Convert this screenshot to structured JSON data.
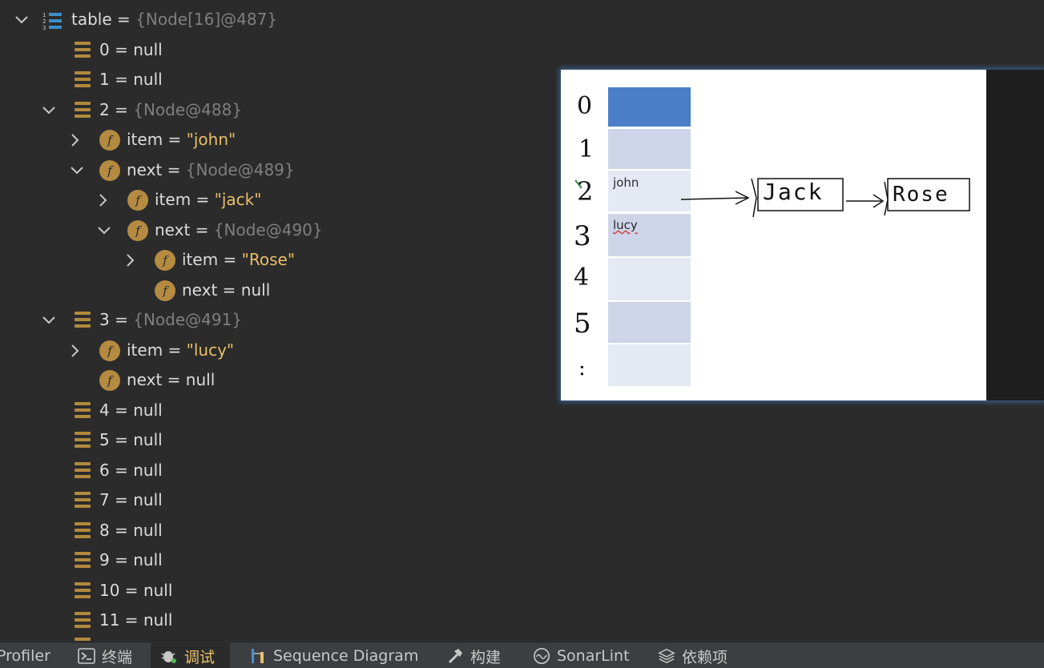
{
  "variables": {
    "rows": [
      {
        "name": "table",
        "eq": " = ",
        "value": "{Node[16]@487}",
        "kind": "ref",
        "icon": "list-icon",
        "chevron": "expanded"
      },
      {
        "name": "0",
        "eq": " = ",
        "value": "null",
        "kind": "plain",
        "icon": "array-element-icon",
        "chevron": "none"
      },
      {
        "name": "1",
        "eq": " = ",
        "value": "null",
        "kind": "plain",
        "icon": "array-element-icon",
        "chevron": "none"
      },
      {
        "name": "2",
        "eq": " = ",
        "value": "{Node@488}",
        "kind": "ref",
        "icon": "array-element-icon",
        "chevron": "expanded"
      },
      {
        "name": "item",
        "eq": " = ",
        "value": "\"john\"",
        "kind": "str",
        "icon": "field-icon",
        "chevron": "collapsed"
      },
      {
        "name": "next",
        "eq": " = ",
        "value": "{Node@489}",
        "kind": "ref",
        "icon": "field-icon",
        "chevron": "expanded"
      },
      {
        "name": "item",
        "eq": " = ",
        "value": "\"jack\"",
        "kind": "str",
        "icon": "field-icon",
        "chevron": "collapsed"
      },
      {
        "name": "next",
        "eq": " = ",
        "value": "{Node@490}",
        "kind": "ref",
        "icon": "field-icon",
        "chevron": "expanded"
      },
      {
        "name": "item",
        "eq": " = ",
        "value": "\"Rose\"",
        "kind": "str",
        "icon": "field-icon",
        "chevron": "collapsed"
      },
      {
        "name": "next",
        "eq": " = ",
        "value": "null",
        "kind": "plain",
        "icon": "field-icon",
        "chevron": "none"
      },
      {
        "name": "3",
        "eq": " = ",
        "value": "{Node@491}",
        "kind": "ref",
        "icon": "array-element-icon",
        "chevron": "expanded"
      },
      {
        "name": "item",
        "eq": " = ",
        "value": "\"lucy\"",
        "kind": "str",
        "icon": "field-icon",
        "chevron": "collapsed"
      },
      {
        "name": "next",
        "eq": " = ",
        "value": "null",
        "kind": "plain",
        "icon": "field-icon",
        "chevron": "none"
      },
      {
        "name": "4",
        "eq": " = ",
        "value": "null",
        "kind": "plain",
        "icon": "array-element-icon",
        "chevron": "none"
      },
      {
        "name": "5",
        "eq": " = ",
        "value": "null",
        "kind": "plain",
        "icon": "array-element-icon",
        "chevron": "none"
      },
      {
        "name": "6",
        "eq": " = ",
        "value": "null",
        "kind": "plain",
        "icon": "array-element-icon",
        "chevron": "none"
      },
      {
        "name": "7",
        "eq": " = ",
        "value": "null",
        "kind": "plain",
        "icon": "array-element-icon",
        "chevron": "none"
      },
      {
        "name": "8",
        "eq": " = ",
        "value": "null",
        "kind": "plain",
        "icon": "array-element-icon",
        "chevron": "none"
      },
      {
        "name": "9",
        "eq": " = ",
        "value": "null",
        "kind": "plain",
        "icon": "array-element-icon",
        "chevron": "none"
      },
      {
        "name": "10",
        "eq": " = ",
        "value": "null",
        "kind": "plain",
        "icon": "array-element-icon",
        "chevron": "none"
      },
      {
        "name": "11",
        "eq": " = ",
        "value": "null",
        "kind": "plain",
        "icon": "array-element-icon",
        "chevron": "none"
      }
    ]
  },
  "drawing": {
    "index_labels": [
      "0",
      "1",
      "2",
      "3",
      "4",
      "5",
      ":"
    ],
    "cell_texts": [
      "",
      "",
      "john",
      "lucy",
      "",
      "",
      ""
    ],
    "node_labels": [
      "Jack",
      "Rose"
    ]
  },
  "toolbar": {
    "items": [
      {
        "label": "Profiler",
        "icon": "profiler-icon",
        "active": false
      },
      {
        "label": "终端",
        "icon": "terminal-icon",
        "active": false
      },
      {
        "label": "调试",
        "icon": "debug-bug-icon",
        "active": true
      },
      {
        "label": "Sequence Diagram",
        "icon": "sequence-diagram-icon",
        "active": false
      },
      {
        "label": "构建",
        "icon": "hammer-icon",
        "active": false
      },
      {
        "label": "SonarLint",
        "icon": "sonarlint-icon",
        "active": false
      },
      {
        "label": "依赖项",
        "icon": "layers-icon",
        "active": false
      }
    ]
  },
  "colors": {
    "background": "#2b2b2b",
    "string_value": "#e8bf6a",
    "reference_value": "#7f7f7f",
    "icon_accent": "#b58b41",
    "selected_cell": "#4a7fc8",
    "cell": "#d3d8ea"
  }
}
